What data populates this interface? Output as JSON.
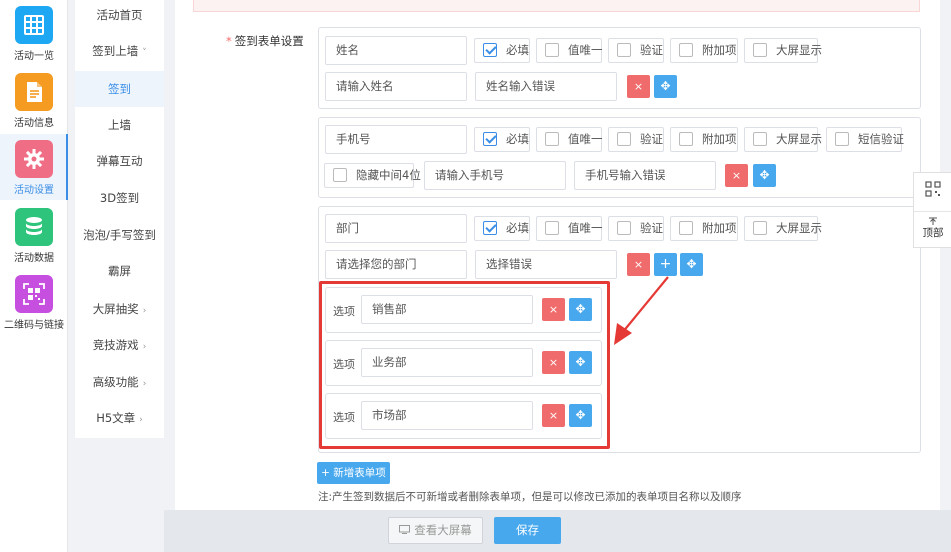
{
  "rail": {
    "items": [
      {
        "label": "活动一览",
        "icon": "grid-icon",
        "color": "#1ea7f2"
      },
      {
        "label": "活动信息",
        "icon": "document-icon",
        "color": "#f59b22"
      },
      {
        "label": "活动设置",
        "icon": "gear-icon",
        "color": "#f06d86"
      },
      {
        "label": "活动数据",
        "icon": "database-icon",
        "color": "#2ec47b"
      },
      {
        "label": "二维码与链接",
        "icon": "qrcode-icon",
        "color": "#c64fe0"
      }
    ]
  },
  "menu": {
    "items": [
      {
        "label": "活动首页",
        "arrow": ""
      },
      {
        "label": "签到上墙",
        "arrow": "˅"
      },
      {
        "label": "签到",
        "arrow": ""
      },
      {
        "label": "上墙",
        "arrow": ""
      },
      {
        "label": "弹幕互动",
        "arrow": ""
      },
      {
        "label": "3D签到",
        "arrow": ""
      },
      {
        "label": "泡泡/手写签到",
        "arrow": ""
      },
      {
        "label": "霸屏",
        "arrow": ""
      },
      {
        "label": "大屏抽奖",
        "arrow": "›"
      },
      {
        "label": "竞技游戏",
        "arrow": "›"
      },
      {
        "label": "高级功能",
        "arrow": "›"
      },
      {
        "label": "H5文章",
        "arrow": "›"
      }
    ]
  },
  "form": {
    "title_star": "*",
    "title": "签到表单设置",
    "groups": [
      {
        "name": "姓名",
        "checks": [
          "必填",
          "值唯一",
          "验证",
          "附加项",
          "大屏显示"
        ],
        "placeholder": "请输入姓名",
        "error": "姓名输入错误"
      },
      {
        "name": "手机号",
        "checks": [
          "必填",
          "值唯一",
          "验证",
          "附加项",
          "大屏显示",
          "短信验证"
        ],
        "extra_check": "隐藏中间4位",
        "placeholder": "请输入手机号",
        "error": "手机号输入错误"
      },
      {
        "name": "部门",
        "checks": [
          "必填",
          "值唯一",
          "验证",
          "附加项",
          "大屏显示"
        ],
        "placeholder": "请选择您的部门",
        "error": "选择错误",
        "option_label": "选项",
        "options": [
          "销售部",
          "业务部",
          "市场部"
        ]
      }
    ],
    "add_button": "+ 新增表单项",
    "note": "注:产生签到数据后不可新增或者删除表单项，但是可以修改已添加的表单项目名称以及顺序"
  },
  "buttons": {
    "delete_glyph": "×",
    "move_glyph": "✥",
    "plus_glyph": "+",
    "preview": "查看大屏幕",
    "save": "保存"
  },
  "side_tools": {
    "qrcode_icon": "qrcode-icon",
    "top_label": "顶部"
  },
  "colors": {
    "accent": "#48a8ee",
    "danger": "#f06b6b",
    "highlight": "#e53935"
  }
}
